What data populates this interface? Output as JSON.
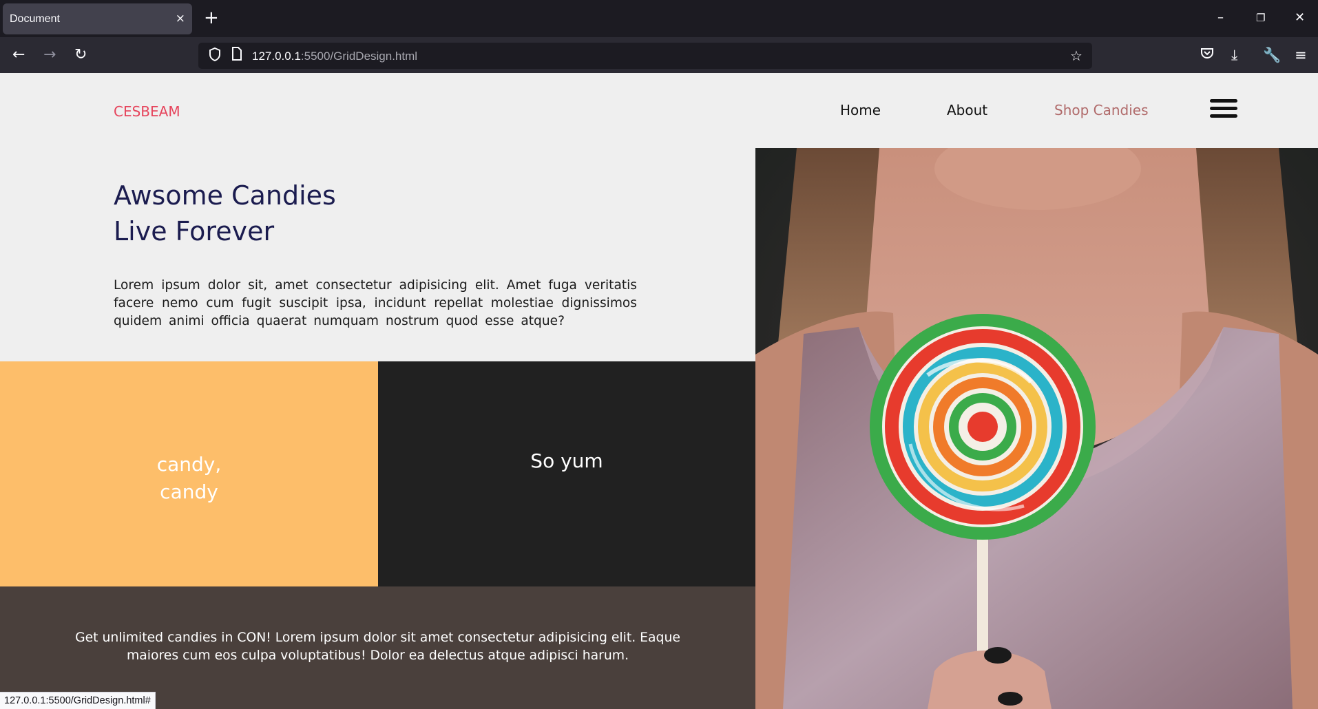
{
  "browser": {
    "tab_title": "Document",
    "tab_close": "×",
    "new_tab": "+",
    "url_host": "127.0.0.1",
    "url_rest": ":5500/GridDesign.html",
    "status_url": "127.0.0.1:5500/GridDesign.html#"
  },
  "site": {
    "brand": "CESBEAM",
    "nav": [
      "Home",
      "About",
      "Shop Candies"
    ],
    "hero_title_line1": "Awsome Candies",
    "hero_title_line2": "Live Forever",
    "hero_text": "Lorem ipsum dolor sit, amet consectetur adipisicing elit. Amet fuga veritatis facere nemo cum fugit suscipit ipsa, incidunt repellat molestiae dignissimos quidem animi officia quaerat numquam nostrum quod esse atque?",
    "orange_line1": "candy,",
    "orange_line2": "candy",
    "dark_text": "So yum",
    "footer_text": "Get unlimited candies in CON! Lorem ipsum dolor sit amet consectetur adipisicing elit. Eaque maiores cum eos culpa voluptatibus! Dolor ea delectus atque adipisci harum."
  },
  "colors": {
    "brand": "#e6435b",
    "title": "#1b1c4f",
    "active_nav": "#b06a6a",
    "orange_panel": "#fdbe6a",
    "dark_panel": "#212121",
    "brown_panel": "#4a403c"
  },
  "icons": [
    "back-icon",
    "forward-icon",
    "reload-icon",
    "shield-icon",
    "page-icon",
    "star-icon",
    "pocket-icon",
    "download-icon",
    "wrench-icon",
    "menu-icon",
    "hamburger-icon",
    "minimize-icon",
    "restore-icon",
    "close-icon"
  ]
}
